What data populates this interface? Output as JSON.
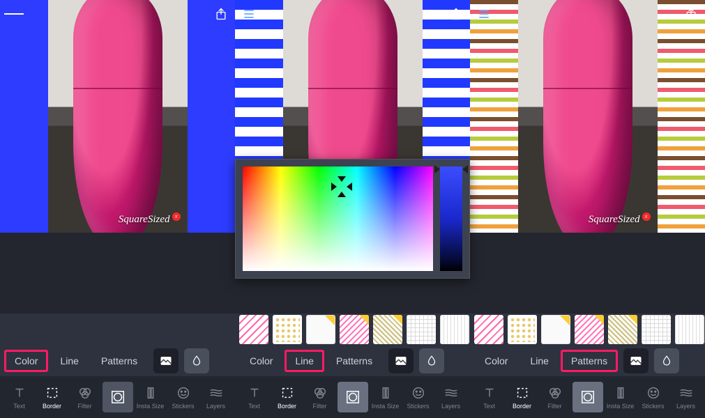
{
  "watermark": "SquareSized",
  "tabs": {
    "color": "Color",
    "line": "Line",
    "patterns": "Patterns"
  },
  "tools": {
    "text": "Text",
    "border": "Border",
    "filter": "Filter",
    "instasize": "Insta Size",
    "stickers": "Stickers",
    "layers": "Layers"
  },
  "panes": [
    {
      "id": "color",
      "selected_tab": "color",
      "border_style": "solid_blue",
      "show_picker": false,
      "show_patterns": false
    },
    {
      "id": "line",
      "selected_tab": "line",
      "border_style": "dashed_blue",
      "show_picker": true,
      "show_patterns": true
    },
    {
      "id": "patterns",
      "selected_tab": "patterns",
      "border_style": "stripes",
      "show_picker": false,
      "show_patterns": true
    }
  ],
  "pattern_swatches": [
    "wave",
    "dots",
    "blank",
    "chev",
    "zig",
    "grid",
    "vlines",
    "hstr",
    "diag",
    "tri",
    "blank"
  ],
  "premium_swatches": [
    2,
    3,
    4,
    7,
    8,
    9
  ],
  "colors": {
    "accent_blue": "#2d3cff",
    "highlight": "#ff1b64"
  },
  "picker": {
    "hue_position": 0.02,
    "sat_x": 0.48,
    "sat_y": 0.12
  }
}
